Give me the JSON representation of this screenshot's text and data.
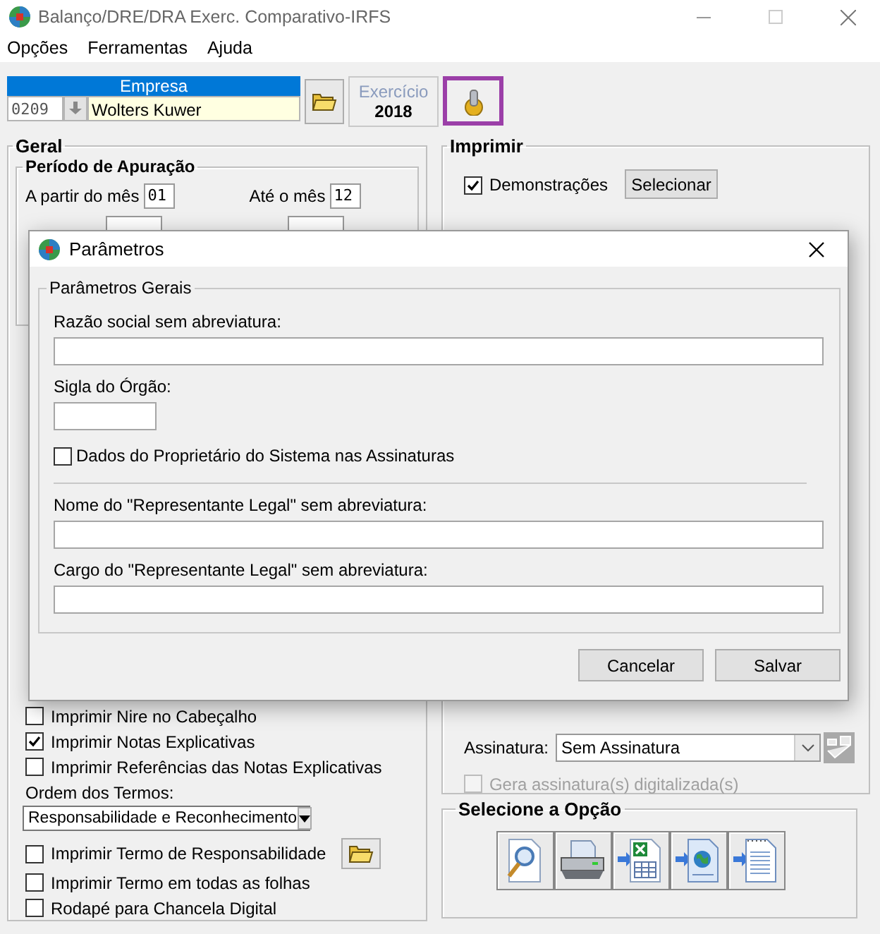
{
  "window": {
    "title": "Balanço/DRE/DRA Exerc. Comparativo-IRFS"
  },
  "menu": [
    "Opções",
    "Ferramentas",
    "Ajuda"
  ],
  "company": {
    "header": "Empresa",
    "code": "0209",
    "name": "Wolters Kuwer"
  },
  "exercise": {
    "label": "Exercício",
    "year": "2018"
  },
  "settings_button": {
    "highlighted": true
  },
  "geral": {
    "title": "Geral",
    "period": {
      "title": "Período de Apuração",
      "from_label": "A partir do mês",
      "from_value": "01",
      "to_label": "Até o mês",
      "to_value": "12"
    },
    "options": [
      {
        "label": "Imprimir Nire no Cabeçalho",
        "checked": false
      },
      {
        "label": "Imprimir Notas Explicativas",
        "checked": true
      },
      {
        "label": "Imprimir Referências das Notas Explicativas",
        "checked": false
      }
    ],
    "order": {
      "label": "Ordem dos Termos:",
      "value": "Responsabilidade e Reconhecimento"
    },
    "term_options": [
      {
        "label": "Imprimir Termo de Responsabilidade",
        "checked": false,
        "kind": "folder"
      },
      {
        "label": "Imprimir Termo em todas as folhas",
        "checked": false,
        "kind": "plain"
      },
      {
        "label": "Rodapé para Chancela Digital",
        "checked": false,
        "kind": "plain"
      }
    ]
  },
  "imprimir": {
    "title": "Imprimir",
    "demonstrations": {
      "label": "Demonstrações",
      "checked": true
    },
    "select_button": "Selecionar",
    "signature": {
      "label": "Assinatura:",
      "value": "Sem Assinatura"
    },
    "digital": {
      "label": "Gera assinatura(s) digitalizada(s)",
      "checked": false,
      "disabled": true
    }
  },
  "options_panel": {
    "title": "Selecione a Opção",
    "actions": [
      {
        "kind": "preview"
      },
      {
        "kind": "print"
      },
      {
        "kind": "excel"
      },
      {
        "kind": "web"
      },
      {
        "kind": "text"
      }
    ]
  },
  "dialog": {
    "title": "Parâmetros",
    "group": "Parâmetros Gerais",
    "items": [
      {
        "kind": "long-field",
        "label": "Razão social sem abreviatura:"
      },
      {
        "kind": "short-field",
        "label": "Sigla do Órgão:"
      },
      {
        "kind": "checkbox",
        "label": "Dados do Proprietário do Sistema nas Assinaturas",
        "checked": false
      },
      {
        "kind": "separator"
      },
      {
        "kind": "long-field",
        "label": "Nome do \"Representante Legal\" sem abreviatura:"
      },
      {
        "kind": "long-field",
        "label": "Cargo do \"Representante Legal\" sem abreviatura:"
      }
    ],
    "buttons": [
      "Cancelar",
      "Salvar"
    ]
  }
}
